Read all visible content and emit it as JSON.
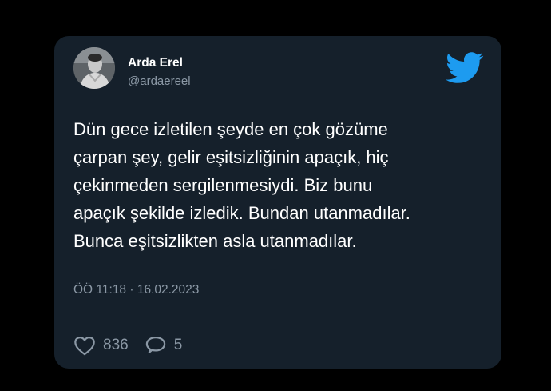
{
  "tweet": {
    "author_name": "Arda Erel",
    "author_handle": "@ardaereel",
    "text_lines": [
      "Dün gece izletilen şeyde en çok gözüme",
      "çarpan şey, gelir eşitsizliğinin apaçık, hiç",
      "çekinmeden sergilenmesiydi. Biz bunu",
      "apaçık şekilde izledik. Bundan utanmadılar.",
      "Bunca eşitsizlikten asla utanmadılar."
    ],
    "timestamp": "ÖÖ 11:18 · 16.02.2023",
    "likes": "836",
    "replies": "5"
  },
  "icons": {
    "brand": "twitter-bird-icon",
    "like": "heart-icon",
    "reply": "speech-bubble-icon"
  },
  "colors": {
    "card_background": "#15202b",
    "page_background": "#000000",
    "twitter_blue": "#1d9bf0",
    "secondary_text": "#8b98a5",
    "primary_text": "#ffffff"
  }
}
